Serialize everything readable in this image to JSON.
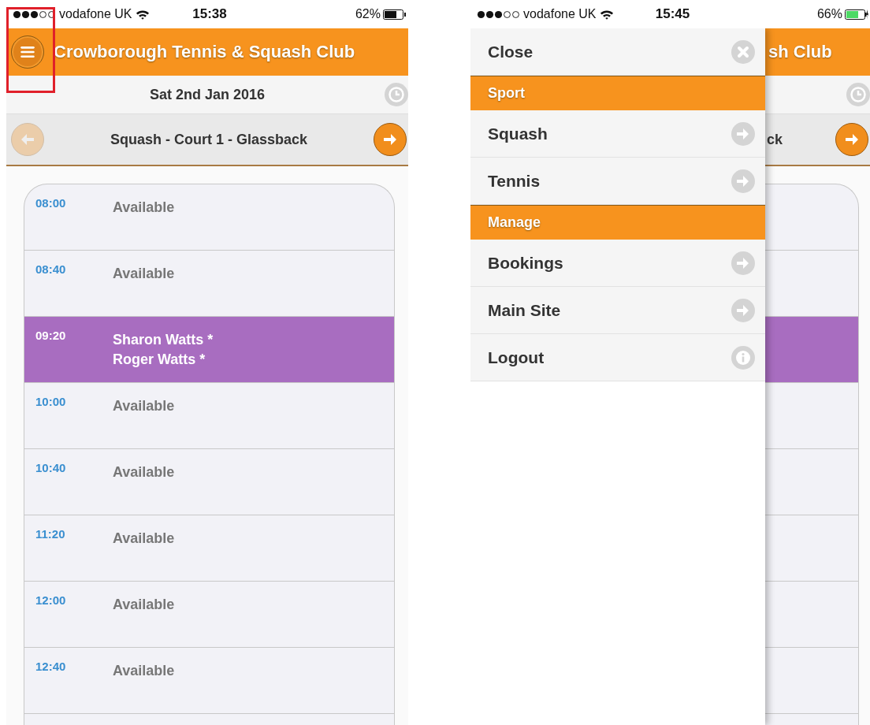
{
  "left": {
    "status": {
      "carrier": "vodafone UK",
      "time": "15:38",
      "battery": "62%",
      "charging": false
    },
    "header": {
      "title": "Crowborough Tennis & Squash Club",
      "menu_highlighted": true
    },
    "date": "Sat 2nd Jan 2016",
    "court": {
      "name": "Squash - Court 1 - Glassback",
      "prev_disabled": true
    },
    "slots": [
      {
        "time": "08:00",
        "booked": false,
        "names": [
          "Available"
        ]
      },
      {
        "time": "08:40",
        "booked": false,
        "names": [
          "Available"
        ]
      },
      {
        "time": "09:20",
        "booked": true,
        "names": [
          "Sharon Watts *",
          "Roger Watts *"
        ]
      },
      {
        "time": "10:00",
        "booked": false,
        "names": [
          "Available"
        ]
      },
      {
        "time": "10:40",
        "booked": false,
        "names": [
          "Available"
        ]
      },
      {
        "time": "11:20",
        "booked": false,
        "names": [
          "Available"
        ]
      },
      {
        "time": "12:00",
        "booked": false,
        "names": [
          "Available"
        ]
      },
      {
        "time": "12:40",
        "booked": false,
        "names": [
          "Available"
        ]
      }
    ]
  },
  "right": {
    "status": {
      "carrier": "vodafone UK",
      "time": "15:45",
      "battery": "66%",
      "charging": true
    },
    "menu": [
      {
        "kind": "close",
        "label": "Close"
      },
      {
        "kind": "header",
        "label": "Sport"
      },
      {
        "kind": "link",
        "label": "Squash"
      },
      {
        "kind": "link",
        "label": "Tennis"
      },
      {
        "kind": "header",
        "label": "Manage"
      },
      {
        "kind": "link",
        "label": "Bookings"
      },
      {
        "kind": "link",
        "label": "Main Site"
      },
      {
        "kind": "info",
        "label": "Logout"
      }
    ],
    "behind": {
      "title": "sh Club",
      "court": "ck",
      "slots": [
        {
          "booked": false
        },
        {
          "booked": false
        },
        {
          "booked": true
        },
        {
          "booked": false
        },
        {
          "booked": false
        },
        {
          "booked": false
        },
        {
          "booked": false
        },
        {
          "booked": false
        }
      ]
    }
  }
}
